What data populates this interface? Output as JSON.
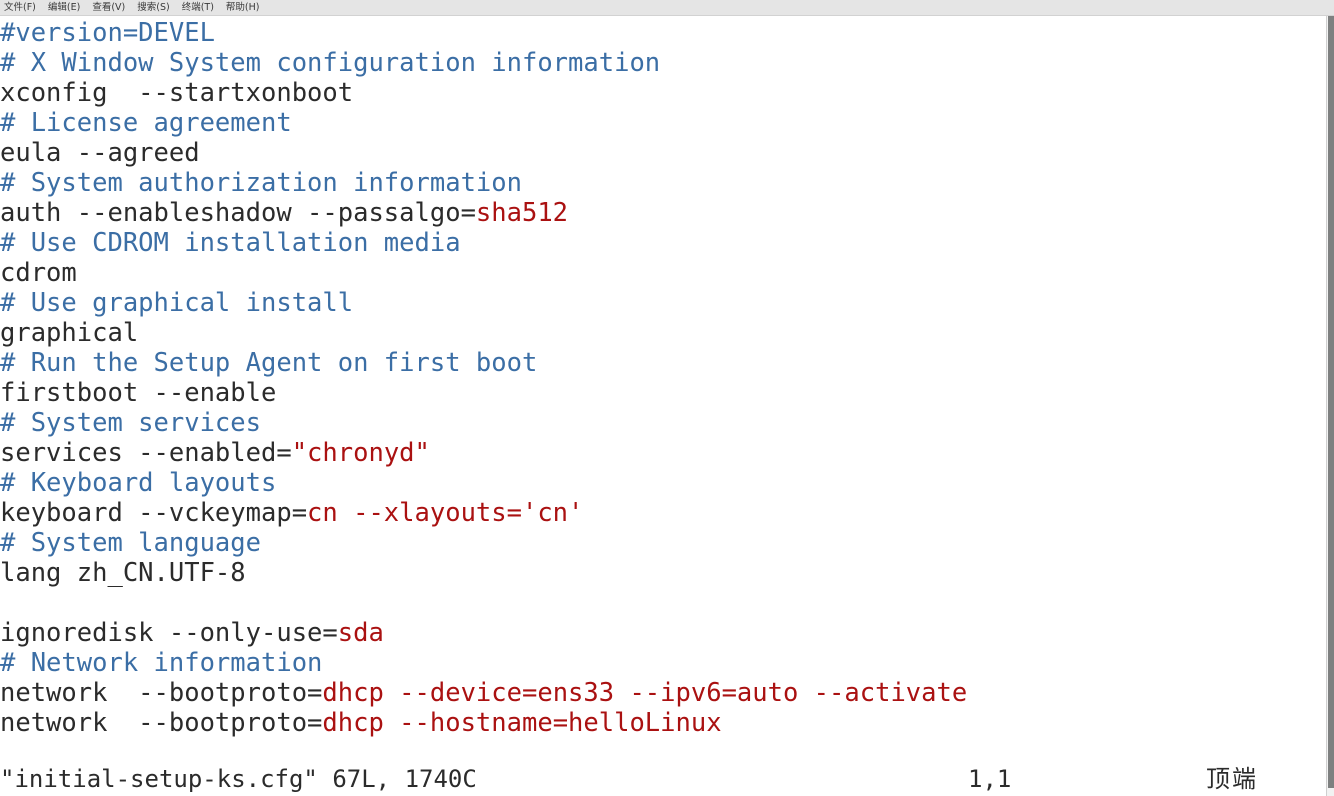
{
  "window": {
    "app": "terminal",
    "program": "vim"
  },
  "menubar": {
    "items": [
      {
        "name": "menu-file",
        "label": "文件(F)"
      },
      {
        "name": "menu-edit",
        "label": "编辑(E)"
      },
      {
        "name": "menu-view",
        "label": "查看(V)"
      },
      {
        "name": "menu-search",
        "label": "搜索(S)"
      },
      {
        "name": "menu-terminal",
        "label": "终端(T)"
      },
      {
        "name": "menu-help",
        "label": "帮助(H)"
      }
    ]
  },
  "colors": {
    "comment": "#3b6ea5",
    "value": "#aa1111",
    "text": "#2b2b2b",
    "background": "#ffffff",
    "menubar_background": "#e5e5e5",
    "scrollbar_thumb": "#7e8080"
  },
  "editor": {
    "lines": [
      {
        "n": 1,
        "segments": [
          {
            "cls": "cmt",
            "t": "#version=DEVEL"
          }
        ]
      },
      {
        "n": 2,
        "segments": [
          {
            "cls": "cmt",
            "t": "# X Window System configuration information"
          }
        ]
      },
      {
        "n": 3,
        "segments": [
          {
            "cls": "plain",
            "t": "xconfig  --startxonboot"
          }
        ]
      },
      {
        "n": 4,
        "segments": [
          {
            "cls": "cmt",
            "t": "# License agreement"
          }
        ]
      },
      {
        "n": 5,
        "segments": [
          {
            "cls": "plain",
            "t": "eula --agreed"
          }
        ]
      },
      {
        "n": 6,
        "segments": [
          {
            "cls": "cmt",
            "t": "# System authorization information"
          }
        ]
      },
      {
        "n": 7,
        "segments": [
          {
            "cls": "plain",
            "t": "auth --enableshadow --passalgo="
          },
          {
            "cls": "val",
            "t": "sha512"
          }
        ]
      },
      {
        "n": 8,
        "segments": [
          {
            "cls": "cmt",
            "t": "# Use CDROM installation media"
          }
        ]
      },
      {
        "n": 9,
        "segments": [
          {
            "cls": "plain",
            "t": "cdrom"
          }
        ]
      },
      {
        "n": 10,
        "segments": [
          {
            "cls": "cmt",
            "t": "# Use graphical install"
          }
        ]
      },
      {
        "n": 11,
        "segments": [
          {
            "cls": "plain",
            "t": "graphical"
          }
        ]
      },
      {
        "n": 12,
        "segments": [
          {
            "cls": "cmt",
            "t": "# Run the Setup Agent on first boot"
          }
        ]
      },
      {
        "n": 13,
        "segments": [
          {
            "cls": "plain",
            "t": "firstboot --enable"
          }
        ]
      },
      {
        "n": 14,
        "segments": [
          {
            "cls": "cmt",
            "t": "# System services"
          }
        ]
      },
      {
        "n": 15,
        "segments": [
          {
            "cls": "plain",
            "t": "services --enabled="
          },
          {
            "cls": "val",
            "t": "\"chronyd\""
          }
        ]
      },
      {
        "n": 16,
        "segments": [
          {
            "cls": "cmt",
            "t": "# Keyboard layouts"
          }
        ]
      },
      {
        "n": 17,
        "segments": [
          {
            "cls": "plain",
            "t": "keyboard --vckeymap="
          },
          {
            "cls": "val",
            "t": "cn --xlayouts='cn'"
          }
        ]
      },
      {
        "n": 18,
        "segments": [
          {
            "cls": "cmt",
            "t": "# System language"
          }
        ]
      },
      {
        "n": 19,
        "segments": [
          {
            "cls": "plain",
            "t": "lang zh_CN.UTF-8"
          }
        ]
      },
      {
        "n": 20,
        "segments": [
          {
            "cls": "plain",
            "t": ""
          }
        ]
      },
      {
        "n": 21,
        "segments": [
          {
            "cls": "plain",
            "t": "ignoredisk --only-use="
          },
          {
            "cls": "val",
            "t": "sda"
          }
        ]
      },
      {
        "n": 22,
        "segments": [
          {
            "cls": "cmt",
            "t": "# Network information"
          }
        ]
      },
      {
        "n": 23,
        "segments": [
          {
            "cls": "plain",
            "t": "network  --bootproto="
          },
          {
            "cls": "val",
            "t": "dhcp --device=ens33 --ipv6=auto --activate"
          }
        ]
      },
      {
        "n": 24,
        "segments": [
          {
            "cls": "plain",
            "t": "network  --bootproto="
          },
          {
            "cls": "val",
            "t": "dhcp --hostname=helloLinux"
          }
        ]
      }
    ]
  },
  "statusline": {
    "file": "\"initial-setup-ks.cfg\" 67L, 1740C",
    "position": "1,1",
    "location": "顶端"
  },
  "scrollbar": {
    "name": "vertical-scrollbar"
  }
}
